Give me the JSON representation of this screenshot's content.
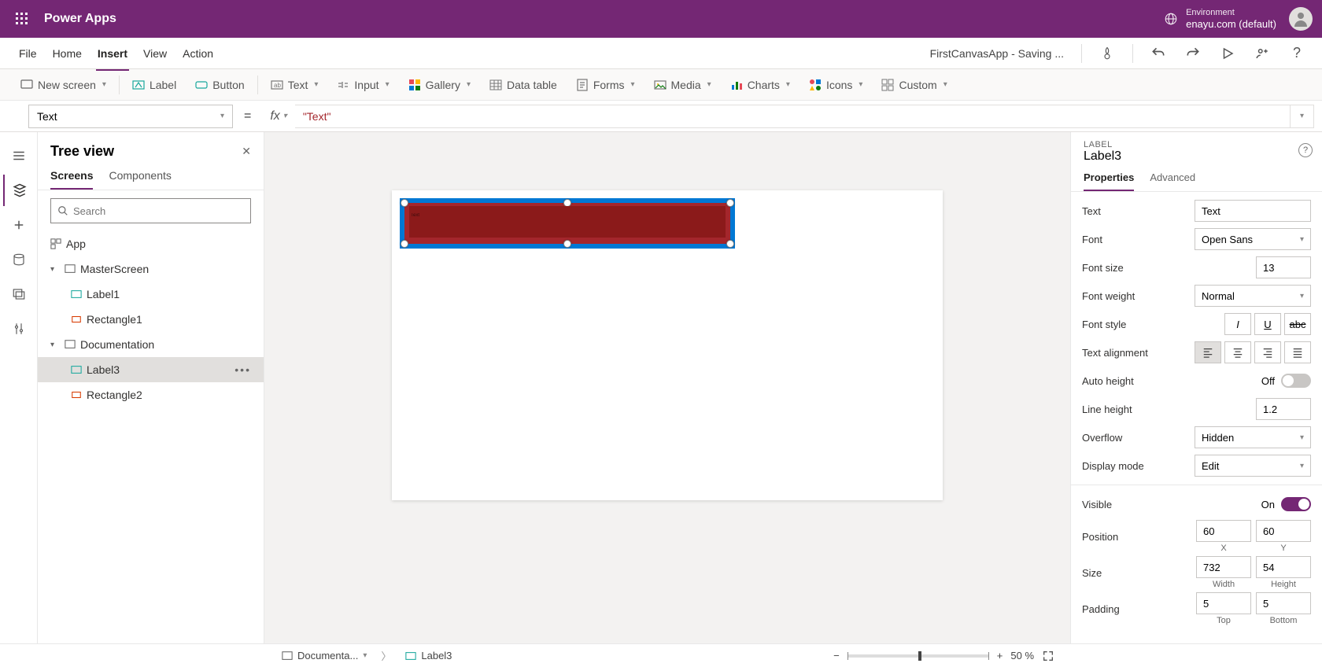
{
  "titlebar": {
    "app_name": "Power Apps",
    "env_label": "Environment",
    "env_value": "enayu.com (default)"
  },
  "menubar": {
    "items": [
      "File",
      "Home",
      "Insert",
      "View",
      "Action"
    ],
    "active": "Insert",
    "file_status": "FirstCanvasApp - Saving ..."
  },
  "ribbon": {
    "new_screen": "New screen",
    "label": "Label",
    "button": "Button",
    "text": "Text",
    "input": "Input",
    "gallery": "Gallery",
    "data_table": "Data table",
    "forms": "Forms",
    "media": "Media",
    "charts": "Charts",
    "icons": "Icons",
    "custom": "Custom"
  },
  "fx": {
    "property": "Text",
    "value": "\"Text\""
  },
  "tree": {
    "title": "Tree view",
    "tabs": {
      "screens": "Screens",
      "components": "Components"
    },
    "search_placeholder": "Search",
    "app": "App",
    "screen1": "MasterScreen",
    "s1_c1": "Label1",
    "s1_c2": "Rectangle1",
    "screen2": "Documentation",
    "s2_c1": "Label3",
    "s2_c2": "Rectangle2"
  },
  "props": {
    "type_label": "LABEL",
    "name": "Label3",
    "tabs": {
      "properties": "Properties",
      "advanced": "Advanced"
    },
    "text_label": "Text",
    "text_value": "Text",
    "font_label": "Font",
    "font_value": "Open Sans",
    "size_label": "Font size",
    "size_value": "13",
    "weight_label": "Font weight",
    "weight_value": "Normal",
    "style_label": "Font style",
    "align_label": "Text alignment",
    "autoh_label": "Auto height",
    "autoh_state": "Off",
    "lineh_label": "Line height",
    "lineh_value": "1.2",
    "overflow_label": "Overflow",
    "overflow_value": "Hidden",
    "dmode_label": "Display mode",
    "dmode_value": "Edit",
    "visible_label": "Visible",
    "visible_state": "On",
    "position_label": "Position",
    "pos_x": "60",
    "pos_y": "60",
    "pos_xl": "X",
    "pos_yl": "Y",
    "sizep_label": "Size",
    "size_w": "732",
    "size_h": "54",
    "size_wl": "Width",
    "size_hl": "Height",
    "padding_label": "Padding",
    "pad_t": "5",
    "pad_b": "5",
    "pad_tl": "Top",
    "pad_bl": "Bottom"
  },
  "status": {
    "screen": "Documenta...",
    "control": "Label3",
    "zoom": "50",
    "zoom_suffix": "%"
  }
}
